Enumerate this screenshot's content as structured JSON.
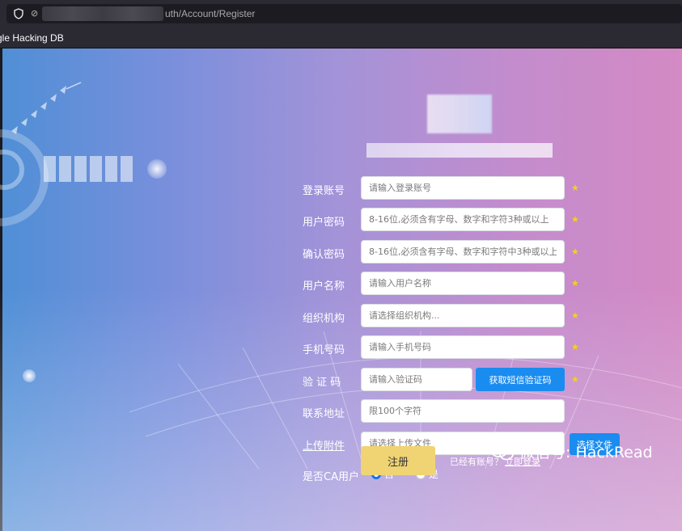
{
  "browser": {
    "url_path": "uth/Account/Register",
    "bookmark": "gle Hacking DB"
  },
  "form": {
    "account": {
      "label": "登录账号",
      "placeholder": "请输入登录账号"
    },
    "password": {
      "label": "用户密码",
      "placeholder": "8-16位,必须含有字母、数字和字符3种或以上"
    },
    "confirm": {
      "label": "确认密码",
      "placeholder": "8-16位,必须含有字母、数字和字符中3种或以上"
    },
    "username": {
      "label": "用户名称",
      "placeholder": "请输入用户名称"
    },
    "org": {
      "label": "组织机构",
      "placeholder": "请选择组织机构..."
    },
    "phone": {
      "label": "手机号码",
      "placeholder": "请输入手机号码"
    },
    "captcha": {
      "label": "验 证 码",
      "placeholder": "请输入验证码",
      "button": "获取短信验证码"
    },
    "address": {
      "label": "联系地址",
      "placeholder": "限100个字符"
    },
    "upload": {
      "label": "上传附件",
      "placeholder": "请选择上传文件",
      "button": "选择文件"
    },
    "ca": {
      "label": "是否CA用户",
      "option_no": "否",
      "option_yes": "是",
      "selected": "否"
    },
    "required_mark": "★",
    "submit": "注册",
    "have_account": "已经有账号？",
    "login_link": "立即登录"
  },
  "watermark": "微信号: HackRead",
  "colors": {
    "accent": "#1a8cf0",
    "submit": "#f0d473",
    "star": "#f5d020"
  }
}
